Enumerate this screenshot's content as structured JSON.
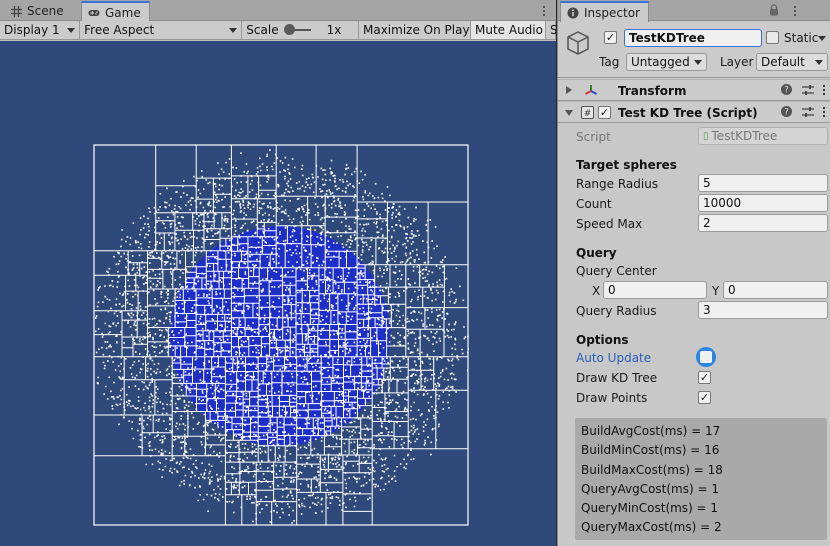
{
  "game_panel": {
    "tabs": [
      {
        "label": "Scene",
        "icon": "grid-icon"
      },
      {
        "label": "Game",
        "icon": "gamepad-icon"
      }
    ],
    "toolbar": {
      "display": "Display 1",
      "aspect": "Free Aspect",
      "scale_label": "Scale",
      "scale_value": "1x",
      "maximize": "Maximize On Play",
      "mute": "Mute Audio",
      "overflow": "S"
    },
    "viewport": {
      "background": "#2f4a7a",
      "box_line_color": "#ffffff",
      "point_color": "#ffffff",
      "inner_fill": "#1e2fc8"
    }
  },
  "inspector": {
    "tab": {
      "label": "Inspector",
      "icon": "info-icon"
    },
    "object": {
      "active": true,
      "name": "TestKDTree",
      "static_label": "Static",
      "tag_label": "Tag",
      "tag_value": "Untagged",
      "layer_label": "Layer",
      "layer_value": "Default"
    },
    "transform": {
      "title": "Transform"
    },
    "script_component": {
      "title": "Test KD Tree (Script)",
      "enabled": true,
      "script_label": "Script",
      "script_value": "TestKDTree",
      "target_title": "Target spheres",
      "range_radius_label": "Range Radius",
      "range_radius_value": "5",
      "count_label": "Count",
      "count_value": "10000",
      "speed_max_label": "Speed Max",
      "speed_max_value": "2",
      "query_title": "Query",
      "query_center_label": "Query Center",
      "x_label": "X",
      "x_value": "0",
      "y_label": "Y",
      "y_value": "0",
      "query_radius_label": "Query Radius",
      "query_radius_value": "3",
      "options_title": "Options",
      "auto_update_label": "Auto Update",
      "draw_kd_label": "Draw KD Tree",
      "draw_kd_checked": true,
      "draw_points_label": "Draw Points",
      "draw_points_checked": true
    },
    "stats": [
      "BuildAvgCost(ms) = 17",
      "BuildMinCost(ms) = 16",
      "BuildMaxCost(ms) = 18",
      "QueryAvgCost(ms) = 1",
      "QueryMinCost(ms) = 1",
      "QueryMaxCost(ms) = 2"
    ]
  }
}
